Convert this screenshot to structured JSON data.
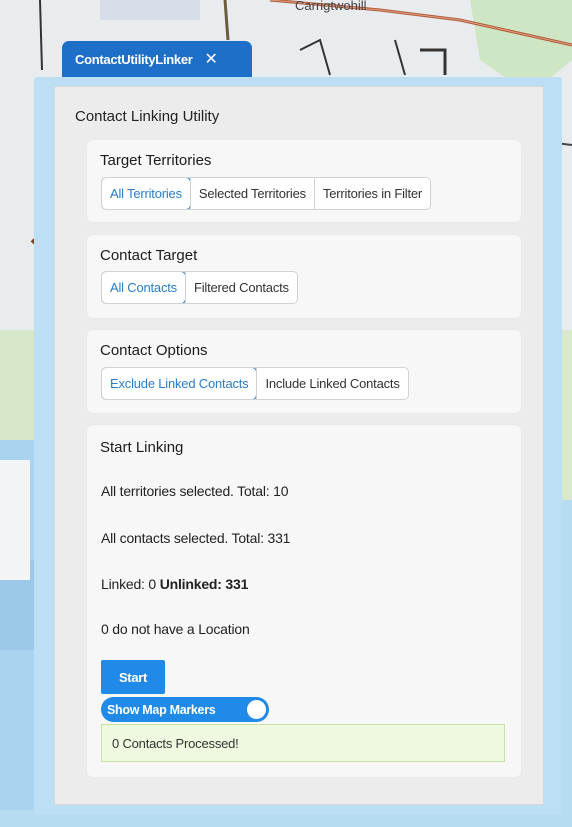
{
  "map": {
    "road_label": "Carrigtwohill"
  },
  "tab": {
    "title": "ContactUtilityLinker",
    "close_glyph": "✕",
    "close_icon": "close-icon"
  },
  "panel": {
    "title": "Contact Linking Utility"
  },
  "target_territories": {
    "title": "Target Territories",
    "options": [
      "All Territories",
      "Selected Territories",
      "Territories in Filter"
    ],
    "selected": "All Territories"
  },
  "contact_target": {
    "title": "Contact Target",
    "options": [
      "All Contacts",
      "Filtered Contacts"
    ],
    "selected": "All Contacts"
  },
  "contact_options": {
    "title": "Contact Options",
    "options": [
      "Exclude Linked Contacts",
      "Include Linked Contacts"
    ],
    "selected": "Exclude Linked Contacts"
  },
  "start_linking": {
    "title": "Start Linking",
    "territories_text": "All territories selected. Total: 10",
    "contacts_text": "All contacts selected. Total: 331",
    "linked_label": "Linked: 0",
    "unlinked_label": "Unlinked: 331",
    "no_location_text": "0 do not have a Location",
    "start_label": "Start",
    "toggle_label": "Show Map Markers",
    "toggle_on": true,
    "status_text": "0 Contacts Processed!"
  },
  "colors": {
    "accent": "#1f8ae8",
    "tab": "#1d6fc8",
    "status_bg": "#eef9df"
  }
}
